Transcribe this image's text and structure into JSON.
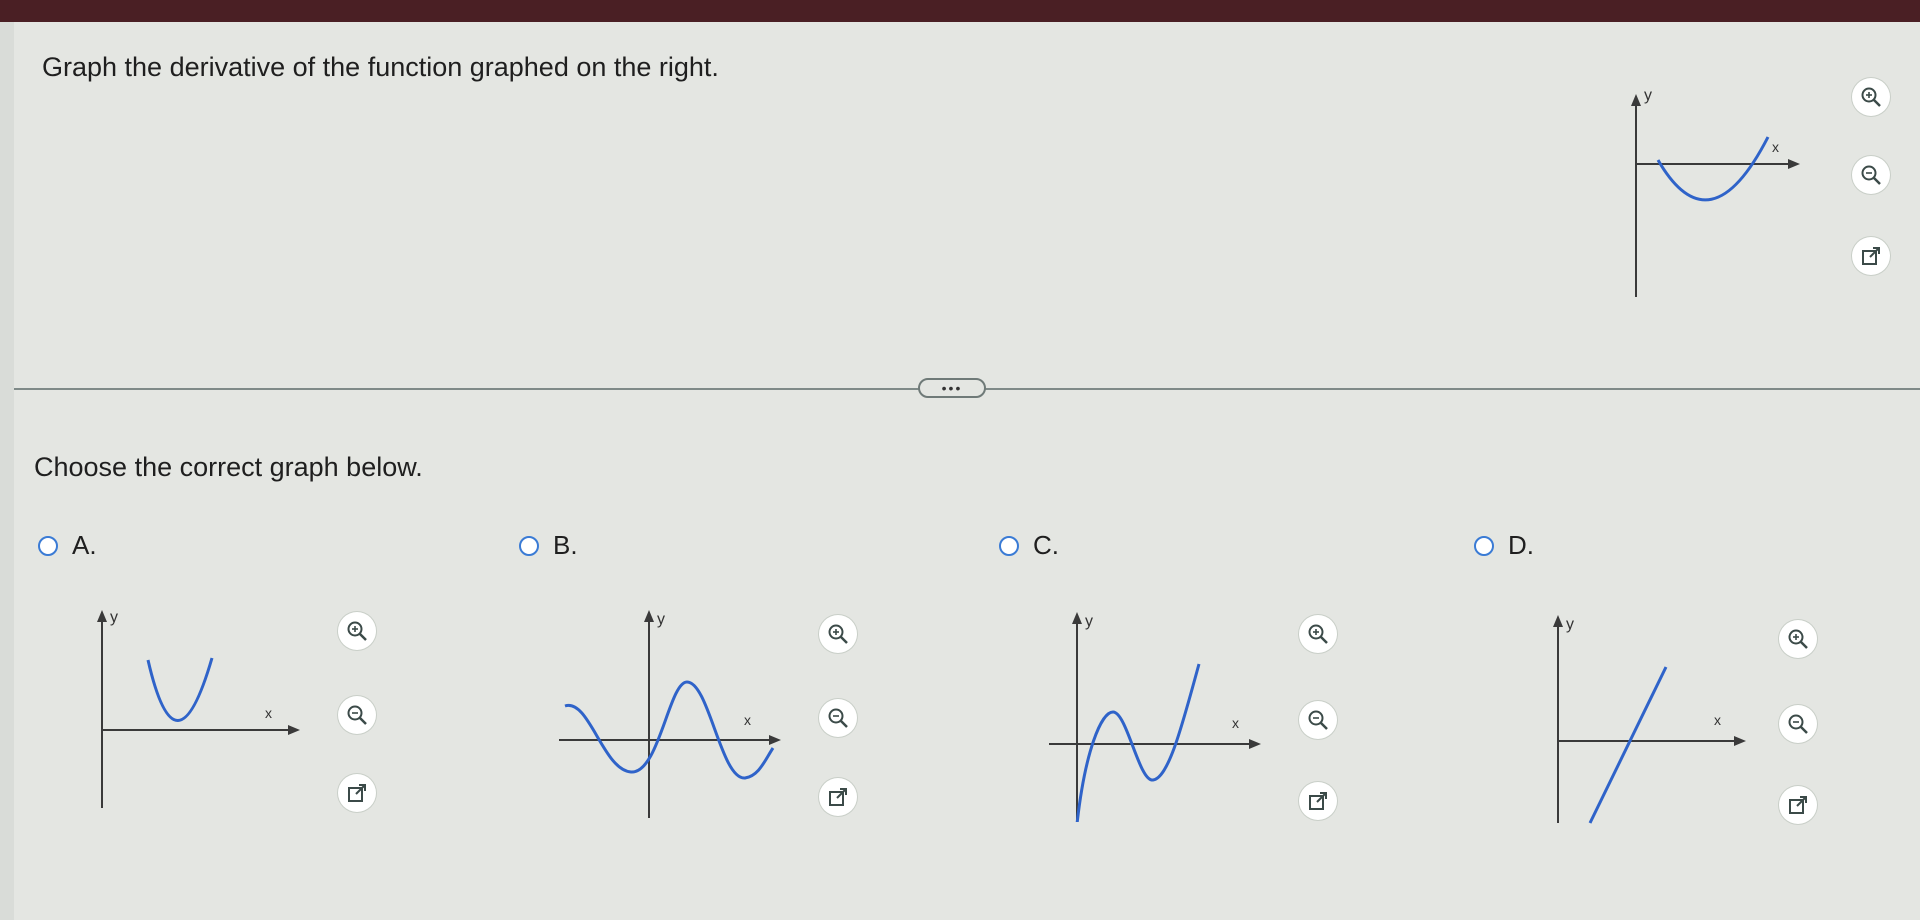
{
  "question": {
    "text": "Graph the derivative of the function graphed on the right."
  },
  "main_graph": {
    "x_label": "x",
    "y_label": "y",
    "tools": [
      "zoom-in-icon",
      "zoom-out-icon",
      "popout-icon"
    ]
  },
  "expand_button": {
    "label": "•••"
  },
  "prompt": {
    "text": "Choose the correct graph below."
  },
  "options": [
    {
      "label": "A.",
      "x_label": "x",
      "y_label": "y"
    },
    {
      "label": "B.",
      "x_label": "x",
      "y_label": "y"
    },
    {
      "label": "C.",
      "x_label": "x",
      "y_label": "y"
    },
    {
      "label": "D.",
      "x_label": "x",
      "y_label": "y"
    }
  ],
  "colors": {
    "curve": "#2f63c9",
    "axis": "#3a3a3a",
    "radio": "#3a7bd5"
  }
}
